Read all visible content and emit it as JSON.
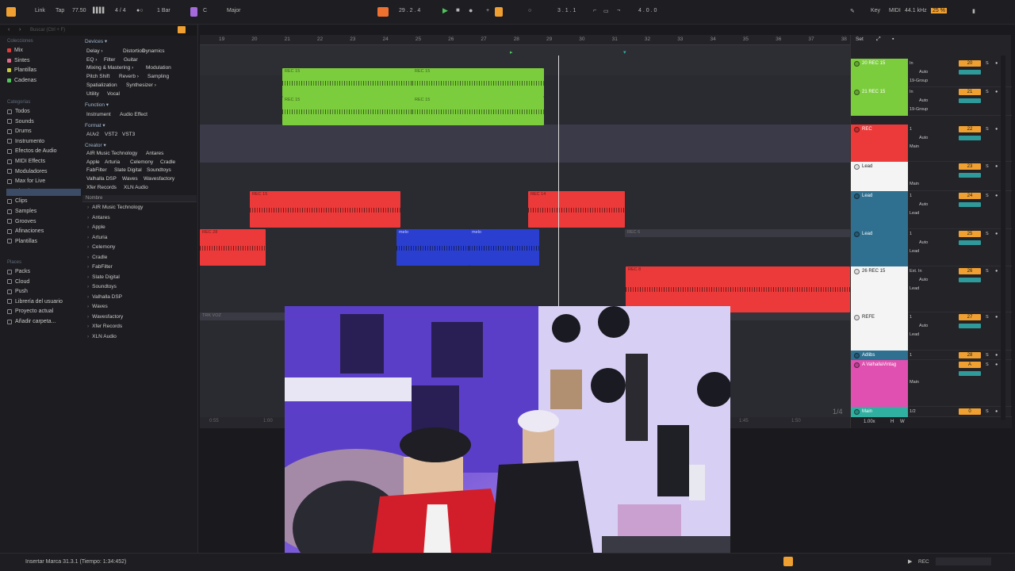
{
  "topbar": {
    "link": "Link",
    "tap": "Tap",
    "tempo": "77.50",
    "signature": "4 / 4",
    "quantize": "1 Bar",
    "key": "C",
    "scale": "Major",
    "position": "29 .  2 .  4",
    "loop_start": "3 .  1 .  1",
    "loop_length": "4 .  0 .  0",
    "key_btn": "Key",
    "midi_btn": "MIDI",
    "sample_rate": "44.1 kHz",
    "cpu": "25 %"
  },
  "browser": {
    "search_placeholder": "Buscar (Ctrl + F)",
    "collections_title": "Colecciones",
    "collections": [
      {
        "label": "Mix",
        "color": "#e53a3a"
      },
      {
        "label": "Sintes",
        "color": "#e06a8a"
      },
      {
        "label": "Plantillas",
        "color": "#c8c83c"
      },
      {
        "label": "Cadenas",
        "color": "#4fc65a"
      }
    ],
    "categories_title": "Categorías",
    "categories": [
      "Todos",
      "Sounds",
      "Drums",
      "Instrumento",
      "Efectos de Audio",
      "MIDI Effects",
      "Moduladores",
      "Max for Live",
      "Plug-ins",
      "Clips",
      "Samples",
      "Grooves",
      "Afinaciones",
      "Plantillas"
    ],
    "places_title": "Places",
    "places": [
      "Packs",
      "Cloud",
      "Push",
      "Librería del usuario",
      "Proyecto actual",
      "Añadir carpeta..."
    ],
    "devices_header": "Devices ▾",
    "device_tags": [
      [
        "Delay ›",
        "Distortion",
        "Dynamics"
      ],
      [
        "EQ ›",
        "Filter",
        "Guitar"
      ],
      [
        "Mixing & Mastering ›",
        "Modulation"
      ],
      [
        "Pitch Shift",
        "Reverb ›",
        "Sampling"
      ],
      [
        "Spatialization",
        "Synthesizer ›"
      ],
      [
        "Utility",
        "Vocal"
      ]
    ],
    "function_header": "Function ▾",
    "function_tags": [
      "Instrument",
      "Audio Effect"
    ],
    "format_header": "Format ▾",
    "format_tags": [
      "AUv2",
      "VST2",
      "VST3"
    ],
    "creator_header": "Creator ▾",
    "creator_tags": [
      [
        "AIR Music Technology",
        "Antares"
      ],
      [
        "Apple",
        "Arturia",
        "Celemony",
        "Cradle"
      ],
      [
        "FabFilter",
        "Slate Digital",
        "Soundtoys"
      ],
      [
        "Valhalla DSP",
        "Waves",
        "Wavesfactory"
      ],
      [
        "Xfer Records",
        "XLN Audio"
      ]
    ],
    "list_header": "Nombre",
    "list": [
      "AIR Music Technology",
      "Antares",
      "Apple",
      "Arturia",
      "Celemony",
      "Cradle",
      "FabFilter",
      "Slate Digital",
      "Soundtoys",
      "Valhalla DSP",
      "Waves",
      "Wavesfactory",
      "Xfer Records",
      "XLN Audio"
    ]
  },
  "ruler": [
    "19",
    "20",
    "21",
    "22",
    "23",
    "24",
    "25",
    "26",
    "27",
    "28",
    "29",
    "30",
    "31",
    "32",
    "33",
    "34",
    "35",
    "36",
    "37",
    "38"
  ],
  "time_left": [
    "0:55",
    "1:00"
  ],
  "time_right": [
    "1:45",
    "1:50"
  ],
  "zoom_label": "1/4",
  "clips": [
    {
      "label": "REC 15",
      "color": "#7ccd3e",
      "lane": 0
    },
    {
      "label": "REC 15",
      "color": "#7ccd3e",
      "lane": 0
    },
    {
      "label": "REC 15",
      "color": "#7ccd3e",
      "lane": 1
    },
    {
      "label": "REC 15",
      "color": "#7ccd3e",
      "lane": 1
    },
    {
      "label": "REC 15",
      "color": "#ec3a3a",
      "lane": 3
    },
    {
      "label": "REC 14",
      "color": "#ec3a3a",
      "lane": 3
    },
    {
      "label": "REC 28",
      "color": "#ec3a3a",
      "lane": 4
    },
    {
      "label": "melo",
      "color": "#2a3fcf",
      "lane": 4
    },
    {
      "label": "melo",
      "color": "#2a3fcf",
      "lane": 4
    },
    {
      "label": "REC 6",
      "color": "#3a3a44",
      "lane": 4
    },
    {
      "label": "REC 8",
      "color": "#ec3a3a",
      "lane": 5
    },
    {
      "label": "TRK VOZ",
      "color": "#3a3a44",
      "lane": 6
    }
  ],
  "mixer": {
    "header_set": "Set",
    "tracks": [
      {
        "name": "20 REC 15",
        "color": "#7ccd3e",
        "input": "In",
        "mode": "Auto",
        "route": "19-Group",
        "num": "20"
      },
      {
        "name": "21 REC 15",
        "color": "#7ccd3e",
        "input": "In",
        "mode": "Auto",
        "route": "19-Group",
        "num": "21"
      },
      {
        "name": "REC",
        "color": "#ec3a3a",
        "input": "1",
        "mode": "Auto",
        "route": "Main",
        "num": "22"
      },
      {
        "name": "Lead",
        "color": "#f4f4f4",
        "input": "",
        "mode": "",
        "route": "Main",
        "num": "23"
      },
      {
        "name": "Lead",
        "color": "#2f6f8f",
        "input": "1",
        "mode": "Auto",
        "route": "Lead",
        "num": "24"
      },
      {
        "name": "Lead",
        "color": "#2f6f8f",
        "input": "1",
        "mode": "Auto",
        "route": "Lead",
        "num": "25"
      },
      {
        "name": "26 REC 15",
        "color": "#f4f4f4",
        "input": "Ext. In",
        "mode": "Auto",
        "route": "Lead",
        "num": "26"
      },
      {
        "name": "REFE",
        "color": "#f4f4f4",
        "input": "1",
        "mode": "Auto",
        "route": "Lead",
        "num": "27"
      },
      {
        "name": "Adlibs",
        "color": "#2f6f8f",
        "input": "1",
        "mode": "",
        "route": "",
        "num": "28"
      },
      {
        "name": "A ValhallaVintag",
        "color": "#e050b0",
        "input": "",
        "mode": "",
        "route": "Main",
        "num": "A"
      },
      {
        "name": "Main",
        "color": "#2fb0a0",
        "input": "1/2",
        "mode": "",
        "route": "",
        "num": "0"
      }
    ],
    "footer_zoom": "1.00x",
    "footer_h": "H",
    "footer_w": "W"
  },
  "status": {
    "message": "Insertar Marca 31.3.1 (Tiempo: 1:34:452)",
    "rec": "REC"
  }
}
